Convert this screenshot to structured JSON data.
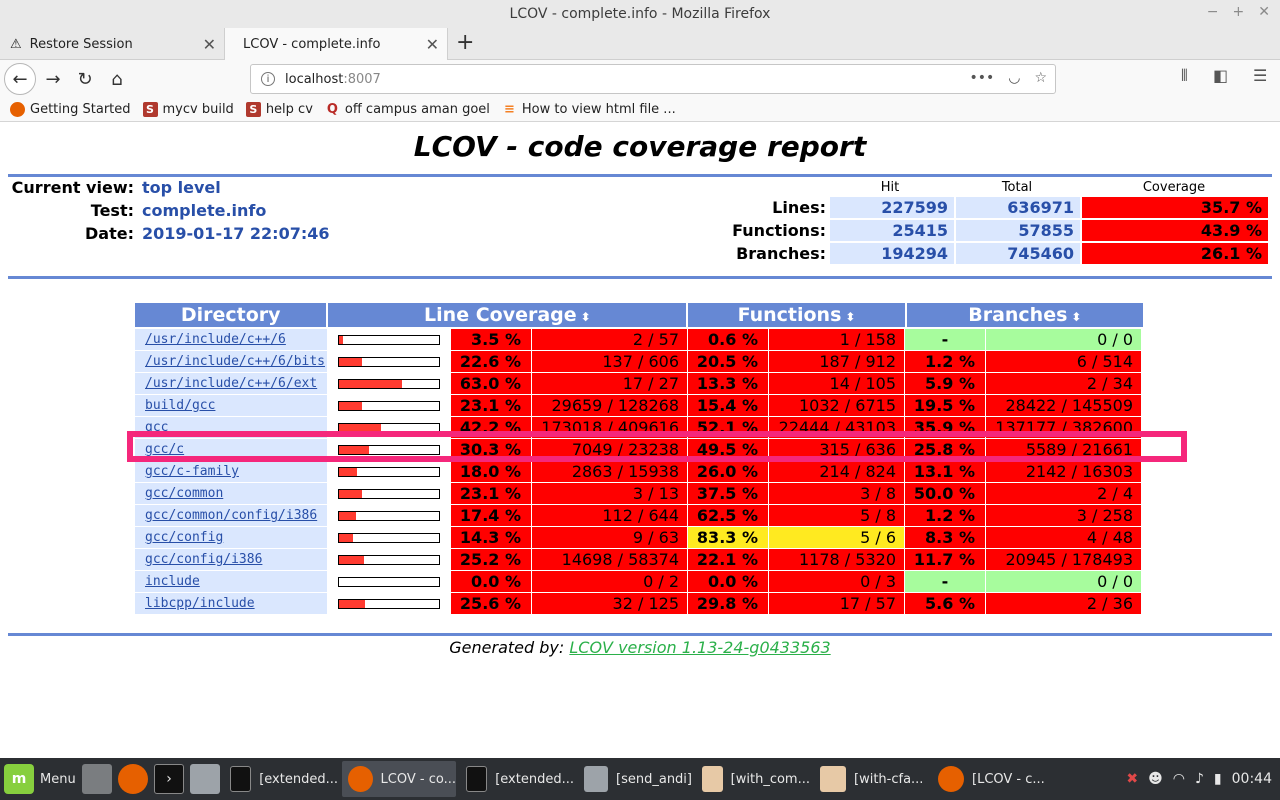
{
  "window": {
    "title": "LCOV - complete.info - Mozilla Firefox"
  },
  "tabs": [
    {
      "label": "Restore Session"
    },
    {
      "label": "LCOV - complete.info"
    }
  ],
  "url": {
    "host": "localhost",
    "port": ":8007"
  },
  "bookmarks": [
    {
      "label": "Getting Started",
      "icon": "firefox-icon"
    },
    {
      "label": "mycv build",
      "icon": "sharelatex-icon"
    },
    {
      "label": "help cv",
      "icon": "sharelatex-icon"
    },
    {
      "label": "off campus aman goel",
      "icon": "quora-icon"
    },
    {
      "label": "How to view html file ...",
      "icon": "stackoverflow-icon"
    }
  ],
  "report": {
    "title": "LCOV - code coverage report",
    "current_view_label": "Current view:",
    "current_view": "top level",
    "test_label": "Test:",
    "test": "complete.info",
    "date_label": "Date:",
    "date": "2019-01-17 22:07:46",
    "summary": {
      "head_hit": "Hit",
      "head_total": "Total",
      "head_coverage": "Coverage",
      "rows": [
        {
          "label": "Lines:",
          "hit": "227599",
          "total": "636971",
          "coverage": "35.7 %"
        },
        {
          "label": "Functions:",
          "hit": "25415",
          "total": "57855",
          "coverage": "43.9 %"
        },
        {
          "label": "Branches:",
          "hit": "194294",
          "total": "745460",
          "coverage": "26.1 %"
        }
      ]
    },
    "columns": {
      "directory": "Directory",
      "line_coverage": "Line Coverage",
      "functions": "Functions",
      "branches": "Branches"
    },
    "rows": [
      {
        "dir": "/usr/include/c++/6",
        "bar": 0.035,
        "lpct": "3.5 %",
        "lval": "2 / 57",
        "fpct": "0.6 %",
        "fval": "1 / 158",
        "fcol": "red",
        "bpct": "-",
        "bval": "0 / 0",
        "bcol": "green"
      },
      {
        "dir": "/usr/include/c++/6/bits",
        "bar": 0.226,
        "lpct": "22.6 %",
        "lval": "137 / 606",
        "fpct": "20.5 %",
        "fval": "187 / 912",
        "fcol": "red",
        "bpct": "1.2 %",
        "bval": "6 / 514",
        "bcol": "red"
      },
      {
        "dir": "/usr/include/c++/6/ext",
        "bar": 0.63,
        "lpct": "63.0 %",
        "lval": "17 / 27",
        "fpct": "13.3 %",
        "fval": "14 / 105",
        "fcol": "red",
        "bpct": "5.9 %",
        "bval": "2 / 34",
        "bcol": "red"
      },
      {
        "dir": "build/gcc",
        "bar": 0.231,
        "lpct": "23.1 %",
        "lval": "29659 / 128268",
        "fpct": "15.4 %",
        "fval": "1032 / 6715",
        "fcol": "red",
        "bpct": "19.5 %",
        "bval": "28422 / 145509",
        "bcol": "red"
      },
      {
        "dir": "gcc",
        "bar": 0.422,
        "lpct": "42.2 %",
        "lval": "173018 / 409616",
        "fpct": "52.1 %",
        "fval": "22444 / 43103",
        "fcol": "red",
        "bpct": "35.9 %",
        "bval": "137177 / 382600",
        "bcol": "red"
      },
      {
        "dir": "gcc/c",
        "bar": 0.303,
        "lpct": "30.3 %",
        "lval": "7049 / 23238",
        "fpct": "49.5 %",
        "fval": "315 / 636",
        "fcol": "red",
        "bpct": "25.8 %",
        "bval": "5589 / 21661",
        "bcol": "red"
      },
      {
        "dir": "gcc/c-family",
        "bar": 0.18,
        "lpct": "18.0 %",
        "lval": "2863 / 15938",
        "fpct": "26.0 %",
        "fval": "214 / 824",
        "fcol": "red",
        "bpct": "13.1 %",
        "bval": "2142 / 16303",
        "bcol": "red"
      },
      {
        "dir": "gcc/common",
        "bar": 0.231,
        "lpct": "23.1 %",
        "lval": "3 / 13",
        "fpct": "37.5 %",
        "fval": "3 / 8",
        "fcol": "red",
        "bpct": "50.0 %",
        "bval": "2 / 4",
        "bcol": "red"
      },
      {
        "dir": "gcc/common/config/i386",
        "bar": 0.174,
        "lpct": "17.4 %",
        "lval": "112 / 644",
        "fpct": "62.5 %",
        "fval": "5 / 8",
        "fcol": "red",
        "bpct": "1.2 %",
        "bval": "3 / 258",
        "bcol": "red"
      },
      {
        "dir": "gcc/config",
        "bar": 0.143,
        "lpct": "14.3 %",
        "lval": "9 / 63",
        "fpct": "83.3 %",
        "fval": "5 / 6",
        "fcol": "yellow",
        "bpct": "8.3 %",
        "bval": "4 / 48",
        "bcol": "red"
      },
      {
        "dir": "gcc/config/i386",
        "bar": 0.252,
        "lpct": "25.2 %",
        "lval": "14698 / 58374",
        "fpct": "22.1 %",
        "fval": "1178 / 5320",
        "fcol": "red",
        "bpct": "11.7 %",
        "bval": "20945 / 178493",
        "bcol": "red"
      },
      {
        "dir": "include",
        "bar": 0.0,
        "lpct": "0.0 %",
        "lval": "0 / 2",
        "fpct": "0.0 %",
        "fval": "0 / 3",
        "fcol": "red",
        "bpct": "-",
        "bval": "0 / 0",
        "bcol": "green"
      },
      {
        "dir": "libcpp/include",
        "bar": 0.256,
        "lpct": "25.6 %",
        "lval": "32 / 125",
        "fpct": "29.8 %",
        "fval": "17 / 57",
        "fcol": "red",
        "bpct": "5.6 %",
        "bval": "2 / 36",
        "bcol": "red"
      }
    ],
    "footer_prefix": "Generated by:",
    "footer_link": "LCOV version 1.13-24-g0433563"
  },
  "taskbar": {
    "menu_label": "Menu",
    "windows": [
      {
        "label": "[extended...",
        "icon": "terminal-icon",
        "active": false
      },
      {
        "label": "LCOV - co...",
        "icon": "firefox-icon",
        "active": true
      },
      {
        "label": "[extended...",
        "icon": "terminal-icon",
        "active": false
      },
      {
        "label": "[send_andi]",
        "icon": "folder-icon",
        "active": false
      },
      {
        "label": "[with_com...",
        "icon": "eye-icon",
        "active": false
      },
      {
        "label": "[with-cfa...",
        "icon": "eye-icon",
        "active": false
      },
      {
        "label": "[LCOV - c...",
        "icon": "firefox-icon",
        "active": false
      }
    ],
    "clock": "00:44"
  },
  "colors": {
    "red": "#ff0000",
    "yellow": "#ffea20",
    "green": "#a7fc9d",
    "header": "#6688d4",
    "highlight": "#f5277b"
  }
}
